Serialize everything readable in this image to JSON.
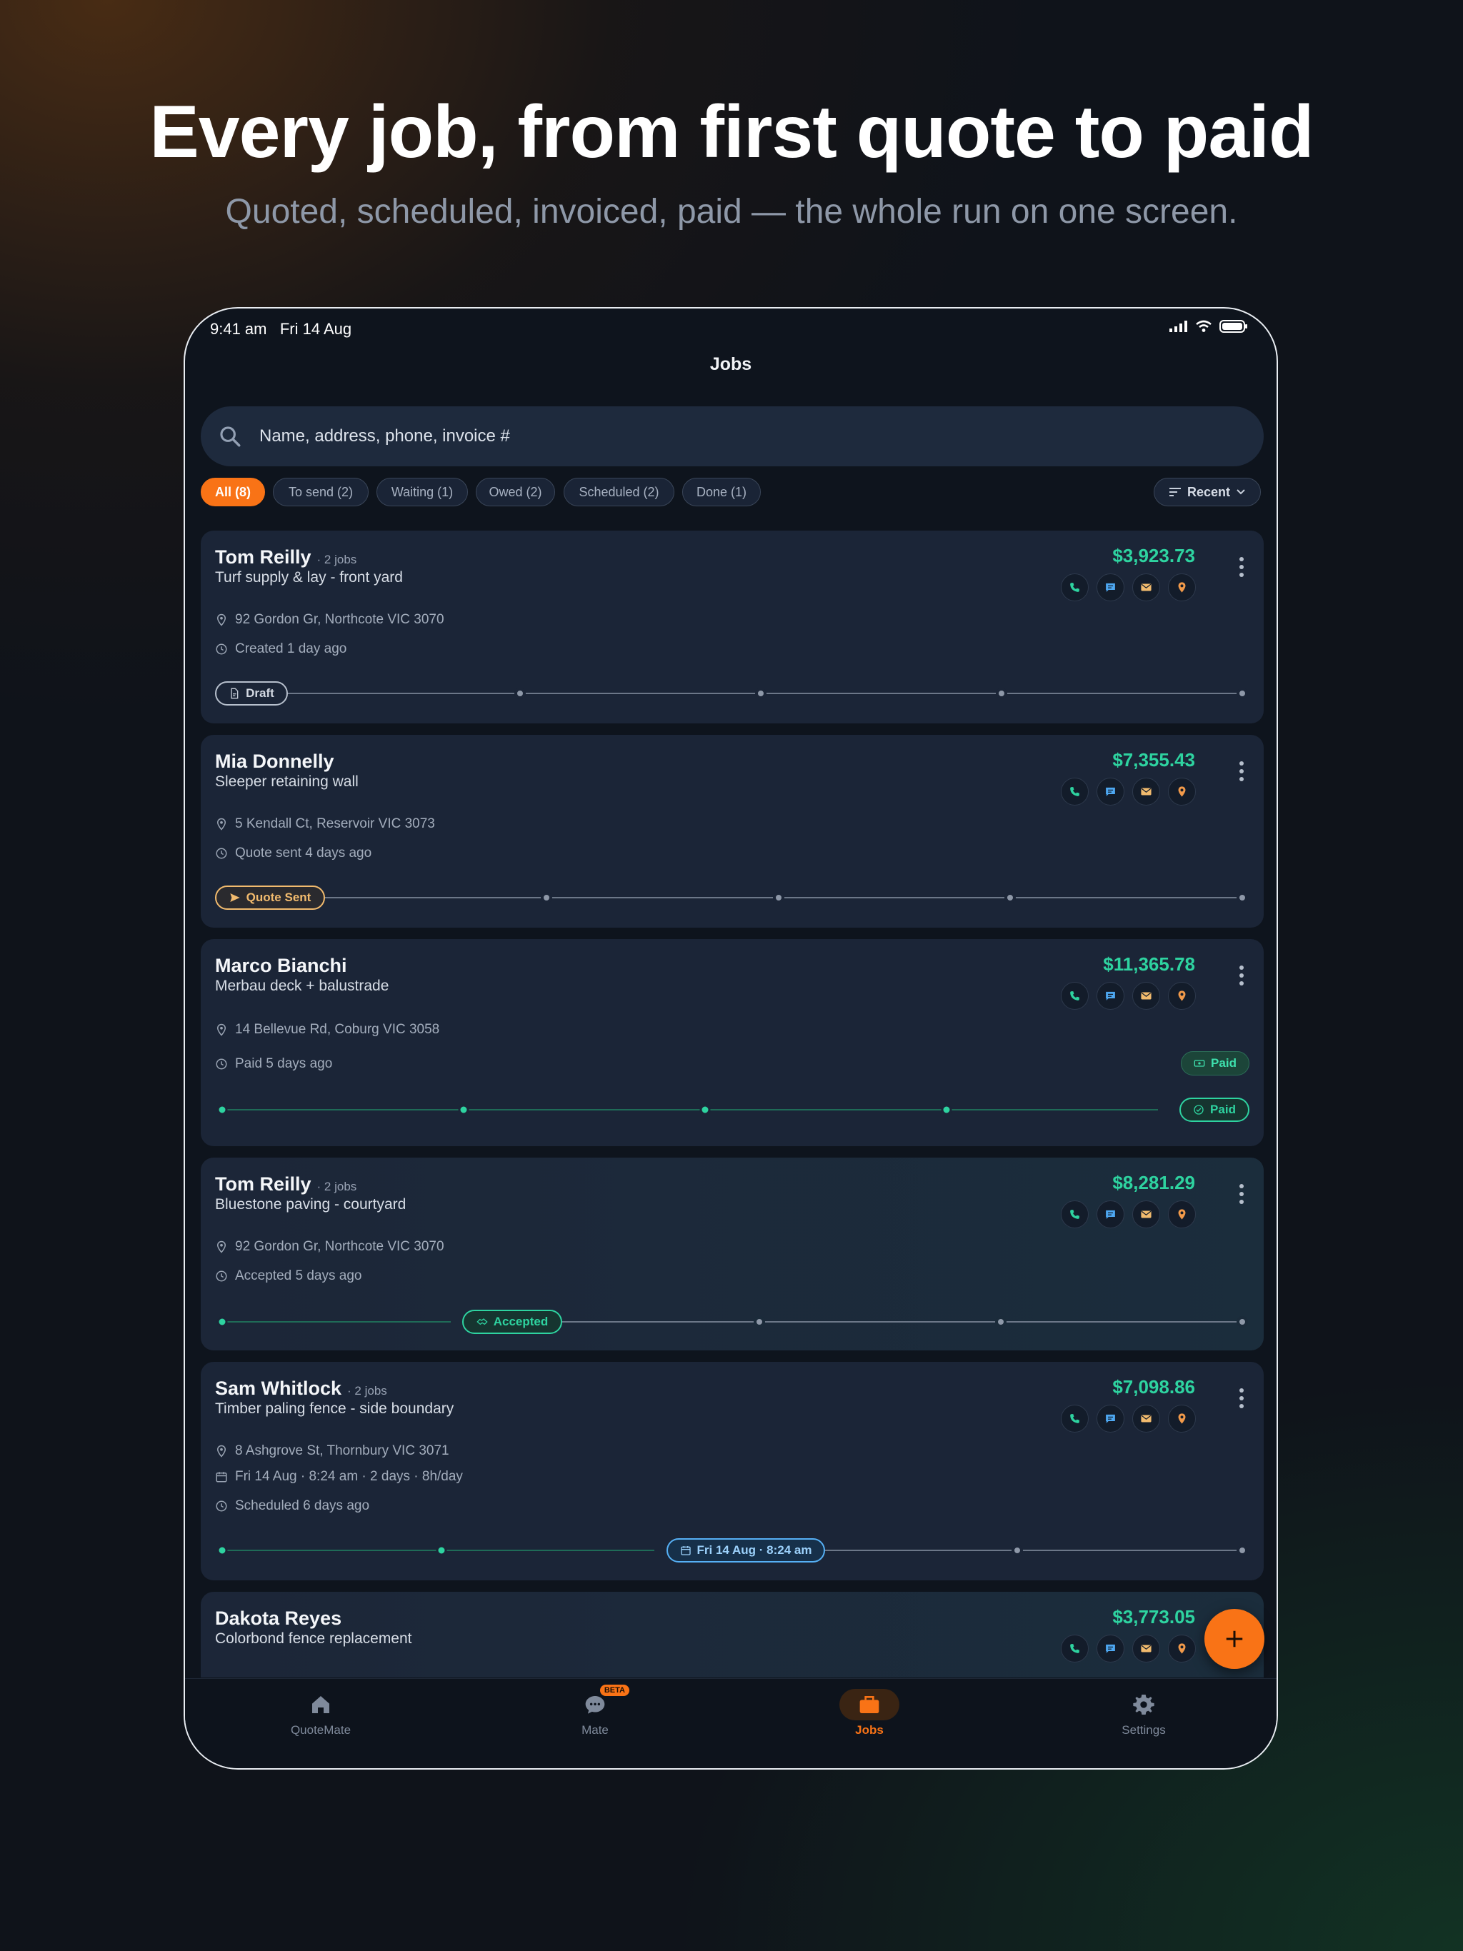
{
  "headline": "Every job, from first quote to paid",
  "subheadline": "Quoted, scheduled, invoiced, paid — the whole run on one screen.",
  "status_bar": {
    "time": "9:41 am",
    "date": "Fri 14 Aug"
  },
  "screen_title": "Jobs",
  "search": {
    "placeholder": "Name, address, phone, invoice #"
  },
  "filters": [
    {
      "label": "All (8)",
      "active": true
    },
    {
      "label": "To send (2)"
    },
    {
      "label": "Waiting (1)"
    },
    {
      "label": "Owed (2)"
    },
    {
      "label": "Scheduled (2)"
    },
    {
      "label": "Done (1)"
    }
  ],
  "sort": {
    "label": "Recent"
  },
  "jobs": [
    {
      "name": "Tom Reilly",
      "sub": "· 2 jobs",
      "title": "Turf supply & lay - front yard",
      "amount": "$3,923.73",
      "address": "92 Gordon Gr, Northcote VIC 3070",
      "status_text": "Created 1 day ago",
      "stage_label": "Draft"
    },
    {
      "name": "Mia Donnelly",
      "title": "Sleeper retaining wall",
      "amount": "$7,355.43",
      "address": "5 Kendall Ct, Reservoir VIC 3073",
      "status_text": "Quote sent 4 days ago",
      "stage_label": "Quote Sent"
    },
    {
      "name": "Marco Bianchi",
      "title": "Merbau deck + balustrade",
      "amount": "$11,365.78",
      "address": "14 Bellevue Rd, Coburg VIC 3058",
      "status_text": "Paid 5 days ago",
      "badge": "Paid",
      "stage_label": "Paid"
    },
    {
      "name": "Tom Reilly",
      "sub": "· 2 jobs",
      "title": "Bluestone paving - courtyard",
      "amount": "$8,281.29",
      "address": "92 Gordon Gr, Northcote VIC 3070",
      "status_text": "Accepted 5 days ago",
      "stage_label": "Accepted"
    },
    {
      "name": "Sam Whitlock",
      "sub": "· 2 jobs",
      "title": "Timber paling fence - side boundary",
      "amount": "$7,098.86",
      "address": "8 Ashgrove St, Thornbury VIC 3071",
      "schedule": "Fri 14 Aug · 8:24 am · 2 days · 8h/day",
      "status_text": "Scheduled 6 days ago",
      "stage_label": "Fri 14 Aug · 8:24 am"
    },
    {
      "name": "Dakota Reyes",
      "title": "Colorbond fence replacement",
      "amount": "$3,773.05"
    }
  ],
  "tabs": [
    {
      "label": "QuoteMate",
      "icon": "home-icon"
    },
    {
      "label": "Mate",
      "icon": "chat-icon",
      "badge": "BETA"
    },
    {
      "label": "Jobs",
      "icon": "briefcase-icon",
      "active": true
    },
    {
      "label": "Settings",
      "icon": "gear-icon"
    }
  ],
  "colors": {
    "accent": "#f97316",
    "money": "#2ed3a0",
    "background": "#0e141d",
    "card": "#1b2537"
  }
}
